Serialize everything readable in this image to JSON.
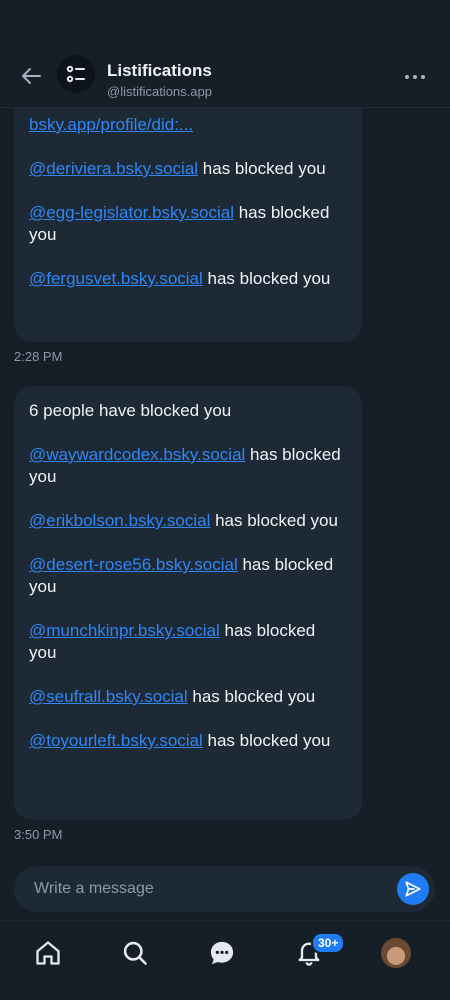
{
  "header": {
    "title": "Listifications",
    "handle": "@listifications.app"
  },
  "messages": [
    {
      "time": "2:28 PM",
      "lines": [
        {
          "link": "bsky.app/profile/did:...",
          "text": ""
        },
        {
          "link": "@deriviera.bsky.social",
          "text": " has blocked you"
        },
        {
          "link": "@egg-legislator.bsky.social",
          "text": " has blocked you"
        },
        {
          "link": "@fergusvet.bsky.social",
          "text": " has blocked you"
        }
      ]
    },
    {
      "time": "3:50 PM",
      "heading": "6 people have blocked you",
      "lines": [
        {
          "link": "@waywardcodex.bsky.social",
          "text": " has blocked you"
        },
        {
          "link": "@erikbolson.bsky.social",
          "text": " has blocked you"
        },
        {
          "link": "@desert-rose56.bsky.social",
          "text": " has blocked you"
        },
        {
          "link": "@munchkinpr.bsky.social",
          "text": " has blocked you"
        },
        {
          "link": "@seufrall.bsky.social",
          "text": " has blocked you"
        },
        {
          "link": "@toyourleft.bsky.social",
          "text": " has blocked you"
        }
      ]
    }
  ],
  "composer": {
    "placeholder": "Write a message",
    "value": ""
  },
  "nav": {
    "items": [
      "home-icon",
      "search-icon",
      "chat-icon",
      "bell-icon",
      "avatar"
    ],
    "notification_badge": "30+"
  },
  "colors": {
    "background": "#161e27",
    "bubble": "#1e2936",
    "link": "#2f86f5",
    "accent": "#1f7cf2",
    "muted": "#8c99a8"
  }
}
